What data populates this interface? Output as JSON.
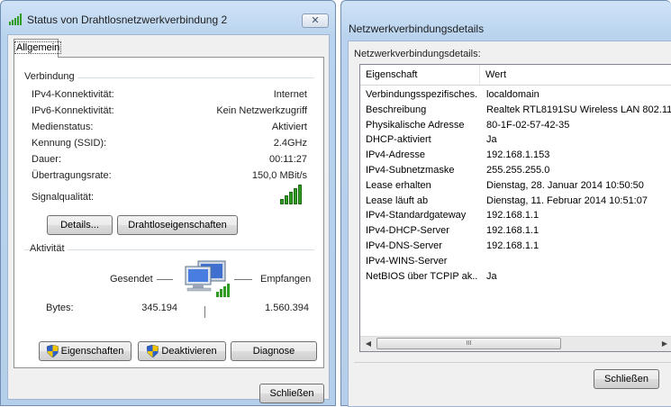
{
  "status_window": {
    "title": "Status von Drahtlosnetzwerkverbindung 2",
    "close_glyph": "✕",
    "tab_label": "Allgemein",
    "connection": {
      "group_label": "Verbindung",
      "rows": [
        {
          "label": "IPv4-Konnektivität:",
          "value": "Internet"
        },
        {
          "label": "IPv6-Konnektivität:",
          "value": "Kein Netzwerkzugriff"
        },
        {
          "label": "Medienstatus:",
          "value": "Aktiviert"
        },
        {
          "label": "Kennung (SSID):",
          "value": "2.4GHz"
        },
        {
          "label": "Dauer:",
          "value": "00:11:27"
        },
        {
          "label": "Übertragungsrate:",
          "value": "150,0 MBit/s"
        }
      ],
      "signal_label": "Signalqualität:",
      "signal_level_bars": 5,
      "signal_max_bars": 5,
      "details_button": "Details...",
      "wireless_props_button": "Drahtloseigenschaften"
    },
    "activity": {
      "group_label": "Aktivität",
      "sent_label": "Gesendet",
      "received_label": "Empfangen",
      "bytes_label": "Bytes:",
      "bytes_sent": "345.194",
      "bytes_received": "1.560.394",
      "properties_button": "Eigenschaften",
      "disable_button": "Deaktivieren",
      "diagnose_button": "Diagnose"
    },
    "close_button": "Schließen"
  },
  "details_window": {
    "title": "Netzwerkverbindungsdetails",
    "caption": "Netzwerkverbindungsdetails:",
    "columns": {
      "property": "Eigenschaft",
      "value": "Wert"
    },
    "rows": [
      {
        "property": "Verbindungsspezifisches...",
        "value": "localdomain"
      },
      {
        "property": "Beschreibung",
        "value": "Realtek RTL8191SU Wireless LAN 802.11"
      },
      {
        "property": "Physikalische Adresse",
        "value": "80-1F-02-57-42-35"
      },
      {
        "property": "DHCP-aktiviert",
        "value": "Ja"
      },
      {
        "property": "IPv4-Adresse",
        "value": "192.168.1.153"
      },
      {
        "property": "IPv4-Subnetzmaske",
        "value": "255.255.255.0"
      },
      {
        "property": "Lease erhalten",
        "value": "Dienstag, 28. Januar 2014 10:50:50"
      },
      {
        "property": "Lease läuft ab",
        "value": "Dienstag, 11. Februar 2014 10:51:07"
      },
      {
        "property": "IPv4-Standardgateway",
        "value": "192.168.1.1"
      },
      {
        "property": "IPv4-DHCP-Server",
        "value": "192.168.1.1"
      },
      {
        "property": "IPv4-DNS-Server",
        "value": "192.168.1.1"
      },
      {
        "property": "IPv4-WINS-Server",
        "value": ""
      },
      {
        "property": "NetBIOS über TCPIP ak...",
        "value": "Ja"
      }
    ],
    "scroll_left_glyph": "◀",
    "scroll_right_glyph": "▶",
    "scroll_thumb_grip": "III",
    "close_button": "Schließen"
  },
  "colors": {
    "signal_green": "#2f9b22",
    "title_gradient_top": "#cfe3f7",
    "dialog_face": "#f0f0f0"
  },
  "icons": [
    "signal-bars-icon",
    "network-computer-icon",
    "uac-shield-icon"
  ]
}
